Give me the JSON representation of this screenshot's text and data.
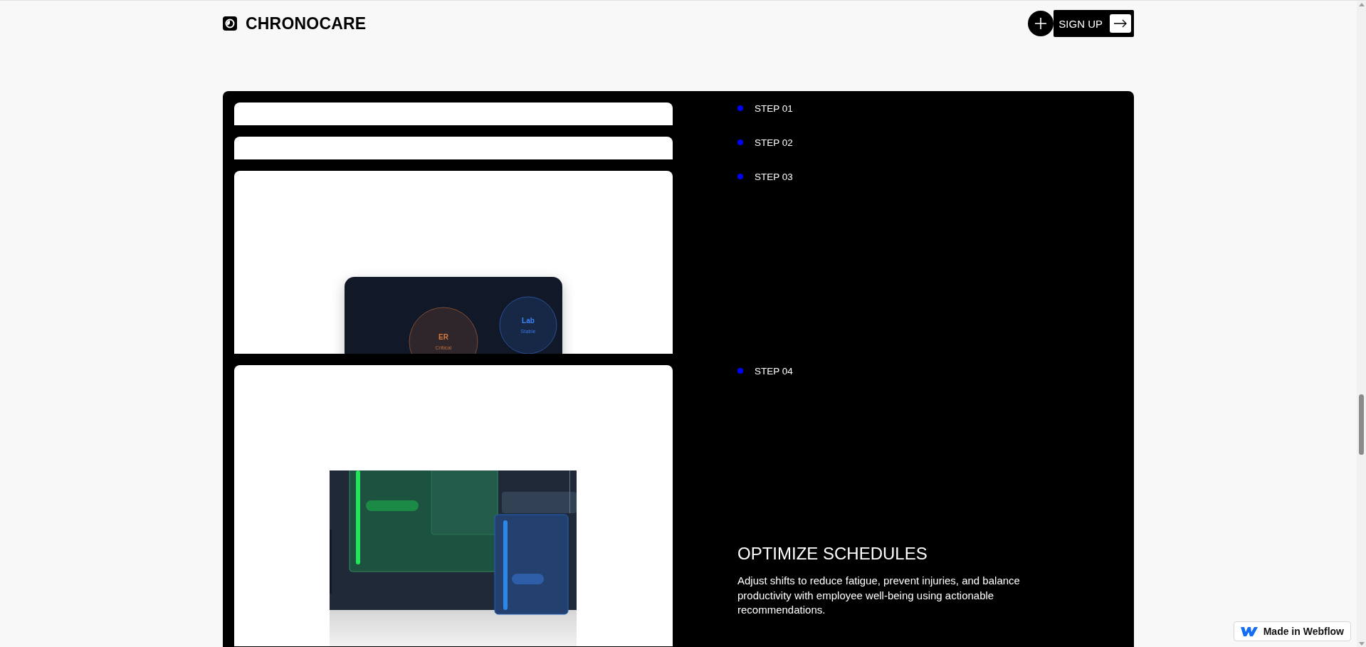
{
  "header": {
    "brand": "CHRONOCARE",
    "signup_label": "SIGN UP"
  },
  "steps": [
    {
      "label": "STEP 01",
      "kind": "empty"
    },
    {
      "label": "STEP 02",
      "kind": "empty"
    },
    {
      "label": "STEP 03",
      "kind": "zones",
      "zones": [
        {
          "name": "ER",
          "status": "Critical",
          "color": "#d97a3c"
        },
        {
          "name": "Lab",
          "status": "Stable",
          "color": "#3b82f6"
        }
      ]
    },
    {
      "label": "STEP 04",
      "kind": "schedule",
      "title": "OPTIMIZE SCHEDULES",
      "description": "Adjust shifts to reduce fatigue, prevent injuries, and balance productivity with employee well-being using actionable recommendations."
    }
  ],
  "badge": {
    "label": "Made in Webflow"
  }
}
